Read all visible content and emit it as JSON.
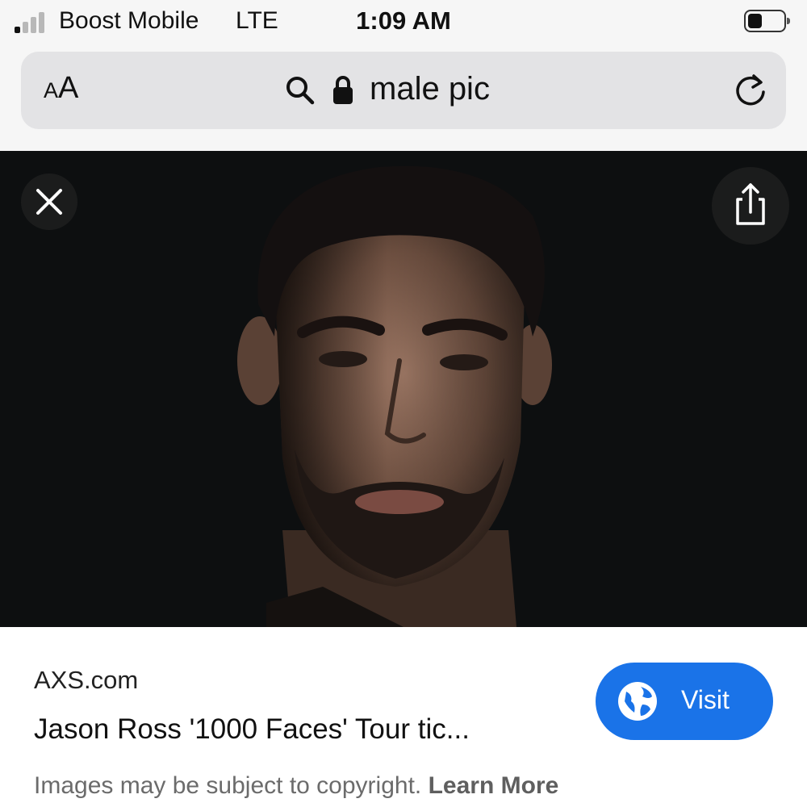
{
  "status_bar": {
    "carrier": "Boost Mobile",
    "network": "LTE",
    "time": "1:09 AM",
    "signal_bars_filled": 1,
    "signal_bars_total": 4,
    "battery_level": 0.4,
    "signal_icon": "signal-bars-icon",
    "battery_icon": "battery-icon"
  },
  "address_bar": {
    "text_size_small": "A",
    "text_size_big": "A",
    "url_text": "male pic",
    "search_icon": "search-icon",
    "lock_icon": "lock-icon",
    "reload_icon": "reload-icon"
  },
  "viewer": {
    "close_icon": "close-icon",
    "share_icon": "share-icon"
  },
  "result": {
    "source": "AXS.com",
    "title": "Jason Ross '1000 Faces' Tour tic...",
    "visit_label": "Visit",
    "visit_icon": "globe-icon",
    "copyright_text": "Images may be subject to copyright.",
    "learn_more": "Learn More"
  },
  "colors": {
    "accent": "#1a73e8",
    "chrome_bg": "#f6f6f6",
    "address_bg": "#e3e3e5",
    "viewer_bg": "#0d0f10"
  }
}
